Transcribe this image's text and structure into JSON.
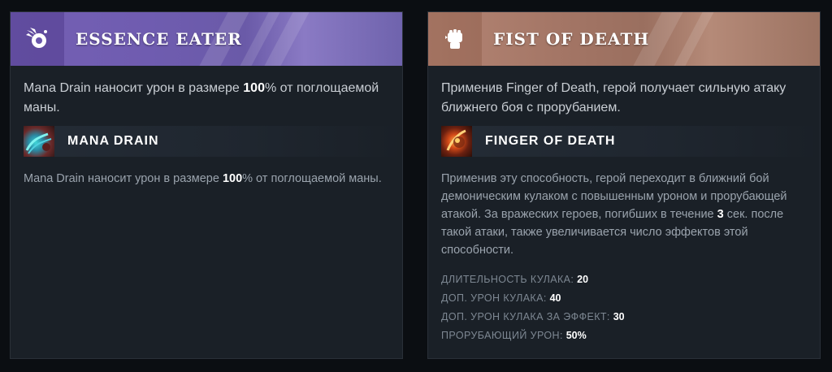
{
  "cards": [
    {
      "title": "ESSENCE EATER",
      "icon": "essence-burst-icon",
      "accent": "#7560b4",
      "desc_before": "Mana Drain наносит урон в размере ",
      "desc_bold": "100",
      "desc_after": "% от поглощаемой маны.",
      "ability": {
        "name": "MANA DRAIN",
        "icon": "mana-drain-ability-icon",
        "desc_before": "Mana Drain наносит урон в размере ",
        "desc_bold": "100",
        "desc_after": "% от поглощаемой маны."
      }
    },
    {
      "title": "FIST OF DEATH",
      "icon": "fist-icon",
      "accent": "#b48574",
      "desc_before": "Применив Finger of Death, герой получает сильную атаку ближнего боя с прорубанием.",
      "ability": {
        "name": "FINGER OF DEATH",
        "icon": "finger-of-death-ability-icon",
        "desc_before": "Применив эту способность, герой переходит в ближний бой демоническим кулаком с повышенным уроном и прорубающей атакой. За вражеских героев, погибших в течение ",
        "desc_bold": "3",
        "desc_after": " сек. после такой атаки, также увеличивается число эффектов этой способности.",
        "stats": [
          {
            "label": "ДЛИТЕЛЬНОСТЬ КУЛАКА:",
            "value": "20"
          },
          {
            "label": "ДОП. УРОН КУЛАКА:",
            "value": "40"
          },
          {
            "label": "ДОП. УРОН КУЛАКА ЗА ЭФФЕКТ:",
            "value": "30"
          },
          {
            "label": "ПРОРУБАЮЩИЙ УРОН:",
            "value": "50%"
          }
        ]
      }
    }
  ]
}
